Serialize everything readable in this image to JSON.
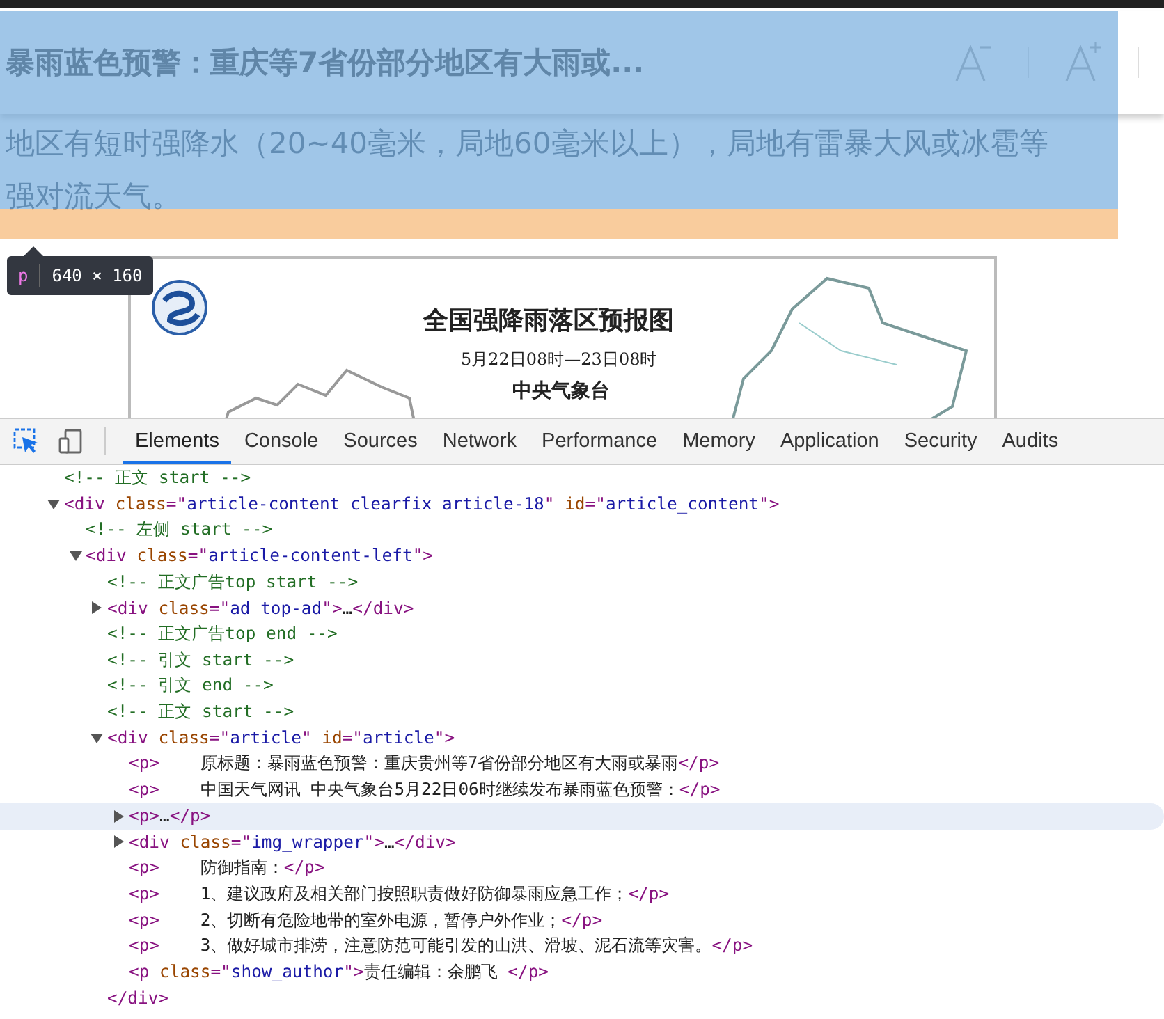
{
  "page": {
    "header": {
      "title": "暴雨蓝色预警：重庆等7省份部分地区有大雨或..."
    },
    "paragraph": "地区有短时强降水（20~40毫米，局地60毫米以上），局地有雷暴大风或冰雹等强对流天气。",
    "map_image": {
      "title": "全国强降雨落区预报图",
      "period": "5月22日08时—23日08时",
      "issuer": "中央气象台"
    }
  },
  "highlight_tooltip": {
    "tag": "p",
    "size": "640 × 160"
  },
  "devtools": {
    "tabs": [
      {
        "label": "Elements",
        "selected": true
      },
      {
        "label": "Console",
        "selected": false
      },
      {
        "label": "Sources",
        "selected": false
      },
      {
        "label": "Network",
        "selected": false
      },
      {
        "label": "Performance",
        "selected": false
      },
      {
        "label": "Memory",
        "selected": false
      },
      {
        "label": "Application",
        "selected": false
      },
      {
        "label": "Security",
        "selected": false
      },
      {
        "label": "Audits",
        "selected": false
      }
    ],
    "tree": [
      {
        "selected": false,
        "segments": [
          {
            "kind": "comment",
            "text": "<!-- 正文 start -->"
          }
        ]
      },
      {
        "selected": false,
        "expanded": true,
        "segments": [
          {
            "kind": "tag",
            "text": "<div "
          },
          {
            "kind": "attr",
            "text": "class"
          },
          {
            "kind": "punct",
            "text": "=\""
          },
          {
            "kind": "value",
            "text": "article-content clearfix article-18"
          },
          {
            "kind": "punct",
            "text": "\" "
          },
          {
            "kind": "attr",
            "text": "id"
          },
          {
            "kind": "punct",
            "text": "=\""
          },
          {
            "kind": "value",
            "text": "article_content"
          },
          {
            "kind": "punct",
            "text": "\""
          },
          {
            "kind": "tag",
            "text": ">"
          }
        ],
        "children": [
          {
            "selected": false,
            "segments": [
              {
                "kind": "comment",
                "text": "<!-- 左侧 start -->"
              }
            ]
          },
          {
            "selected": false,
            "expanded": true,
            "segments": [
              {
                "kind": "tag",
                "text": "<div "
              },
              {
                "kind": "attr",
                "text": "class"
              },
              {
                "kind": "punct",
                "text": "=\""
              },
              {
                "kind": "value",
                "text": "article-content-left"
              },
              {
                "kind": "punct",
                "text": "\""
              },
              {
                "kind": "tag",
                "text": ">"
              }
            ],
            "children": [
              {
                "selected": false,
                "segments": [
                  {
                    "kind": "comment",
                    "text": "<!-- 正文广告top start -->"
                  }
                ]
              },
              {
                "selected": false,
                "expanded": false,
                "segments": [
                  {
                    "kind": "tag",
                    "text": "<div "
                  },
                  {
                    "kind": "attr",
                    "text": "class"
                  },
                  {
                    "kind": "punct",
                    "text": "=\""
                  },
                  {
                    "kind": "value",
                    "text": "ad top-ad"
                  },
                  {
                    "kind": "punct",
                    "text": "\""
                  },
                  {
                    "kind": "tag",
                    "text": ">"
                  },
                  {
                    "kind": "text",
                    "text": "…"
                  },
                  {
                    "kind": "tag",
                    "text": "</div>"
                  }
                ]
              },
              {
                "selected": false,
                "segments": [
                  {
                    "kind": "comment",
                    "text": "<!-- 正文广告top end -->"
                  }
                ]
              },
              {
                "selected": false,
                "segments": [
                  {
                    "kind": "comment",
                    "text": "<!-- 引文 start -->"
                  }
                ]
              },
              {
                "selected": false,
                "segments": [
                  {
                    "kind": "comment",
                    "text": "<!-- 引文 end -->"
                  }
                ]
              },
              {
                "selected": false,
                "segments": [
                  {
                    "kind": "comment",
                    "text": "<!-- 正文 start -->"
                  }
                ]
              },
              {
                "selected": false,
                "expanded": true,
                "segments": [
                  {
                    "kind": "tag",
                    "text": "<div "
                  },
                  {
                    "kind": "attr",
                    "text": "class"
                  },
                  {
                    "kind": "punct",
                    "text": "=\""
                  },
                  {
                    "kind": "value",
                    "text": "article"
                  },
                  {
                    "kind": "punct",
                    "text": "\" "
                  },
                  {
                    "kind": "attr",
                    "text": "id"
                  },
                  {
                    "kind": "punct",
                    "text": "=\""
                  },
                  {
                    "kind": "value",
                    "text": "article"
                  },
                  {
                    "kind": "punct",
                    "text": "\""
                  },
                  {
                    "kind": "tag",
                    "text": ">"
                  }
                ],
                "closing": [
                  {
                    "kind": "tag",
                    "text": "</div>"
                  }
                ],
                "children": [
                  {
                    "selected": false,
                    "segments": [
                      {
                        "kind": "tag",
                        "text": "<p>"
                      },
                      {
                        "kind": "text",
                        "text": "    原标题：暴雨蓝色预警：重庆贵州等7省份部分地区有大雨或暴雨"
                      },
                      {
                        "kind": "tag",
                        "text": "</p>"
                      }
                    ]
                  },
                  {
                    "selected": false,
                    "segments": [
                      {
                        "kind": "tag",
                        "text": "<p>"
                      },
                      {
                        "kind": "text",
                        "text": "    中国天气网讯 中央气象台5月22日06时继续发布暴雨蓝色预警："
                      },
                      {
                        "kind": "tag",
                        "text": "</p>"
                      }
                    ]
                  },
                  {
                    "selected": true,
                    "expanded": false,
                    "segments": [
                      {
                        "kind": "tag",
                        "text": "<p>"
                      },
                      {
                        "kind": "text",
                        "text": "…"
                      },
                      {
                        "kind": "tag",
                        "text": "</p>"
                      }
                    ]
                  },
                  {
                    "selected": false,
                    "expanded": false,
                    "segments": [
                      {
                        "kind": "tag",
                        "text": "<div "
                      },
                      {
                        "kind": "attr",
                        "text": "class"
                      },
                      {
                        "kind": "punct",
                        "text": "=\""
                      },
                      {
                        "kind": "value",
                        "text": "img_wrapper"
                      },
                      {
                        "kind": "punct",
                        "text": "\""
                      },
                      {
                        "kind": "tag",
                        "text": ">"
                      },
                      {
                        "kind": "text",
                        "text": "…"
                      },
                      {
                        "kind": "tag",
                        "text": "</div>"
                      }
                    ]
                  },
                  {
                    "selected": false,
                    "segments": [
                      {
                        "kind": "tag",
                        "text": "<p>"
                      },
                      {
                        "kind": "text",
                        "text": "    防御指南："
                      },
                      {
                        "kind": "tag",
                        "text": "</p>"
                      }
                    ]
                  },
                  {
                    "selected": false,
                    "segments": [
                      {
                        "kind": "tag",
                        "text": "<p>"
                      },
                      {
                        "kind": "text",
                        "text": "    1、建议政府及相关部门按照职责做好防御暴雨应急工作；"
                      },
                      {
                        "kind": "tag",
                        "text": "</p>"
                      }
                    ]
                  },
                  {
                    "selected": false,
                    "segments": [
                      {
                        "kind": "tag",
                        "text": "<p>"
                      },
                      {
                        "kind": "text",
                        "text": "    2、切断有危险地带的室外电源，暂停户外作业；"
                      },
                      {
                        "kind": "tag",
                        "text": "</p>"
                      }
                    ]
                  },
                  {
                    "selected": false,
                    "segments": [
                      {
                        "kind": "tag",
                        "text": "<p>"
                      },
                      {
                        "kind": "text",
                        "text": "    3、做好城市排涝，注意防范可能引发的山洪、滑坡、泥石流等灾害。"
                      },
                      {
                        "kind": "tag",
                        "text": "</p>"
                      }
                    ]
                  },
                  {
                    "selected": false,
                    "segments": [
                      {
                        "kind": "tag",
                        "text": "<p "
                      },
                      {
                        "kind": "attr",
                        "text": "class"
                      },
                      {
                        "kind": "punct",
                        "text": "=\""
                      },
                      {
                        "kind": "value",
                        "text": "show_author"
                      },
                      {
                        "kind": "punct",
                        "text": "\""
                      },
                      {
                        "kind": "tag",
                        "text": ">"
                      },
                      {
                        "kind": "text",
                        "text": "责任编辑：余鹏飞 "
                      },
                      {
                        "kind": "tag",
                        "text": "</p>"
                      }
                    ]
                  }
                ]
              }
            ]
          }
        ]
      }
    ]
  }
}
